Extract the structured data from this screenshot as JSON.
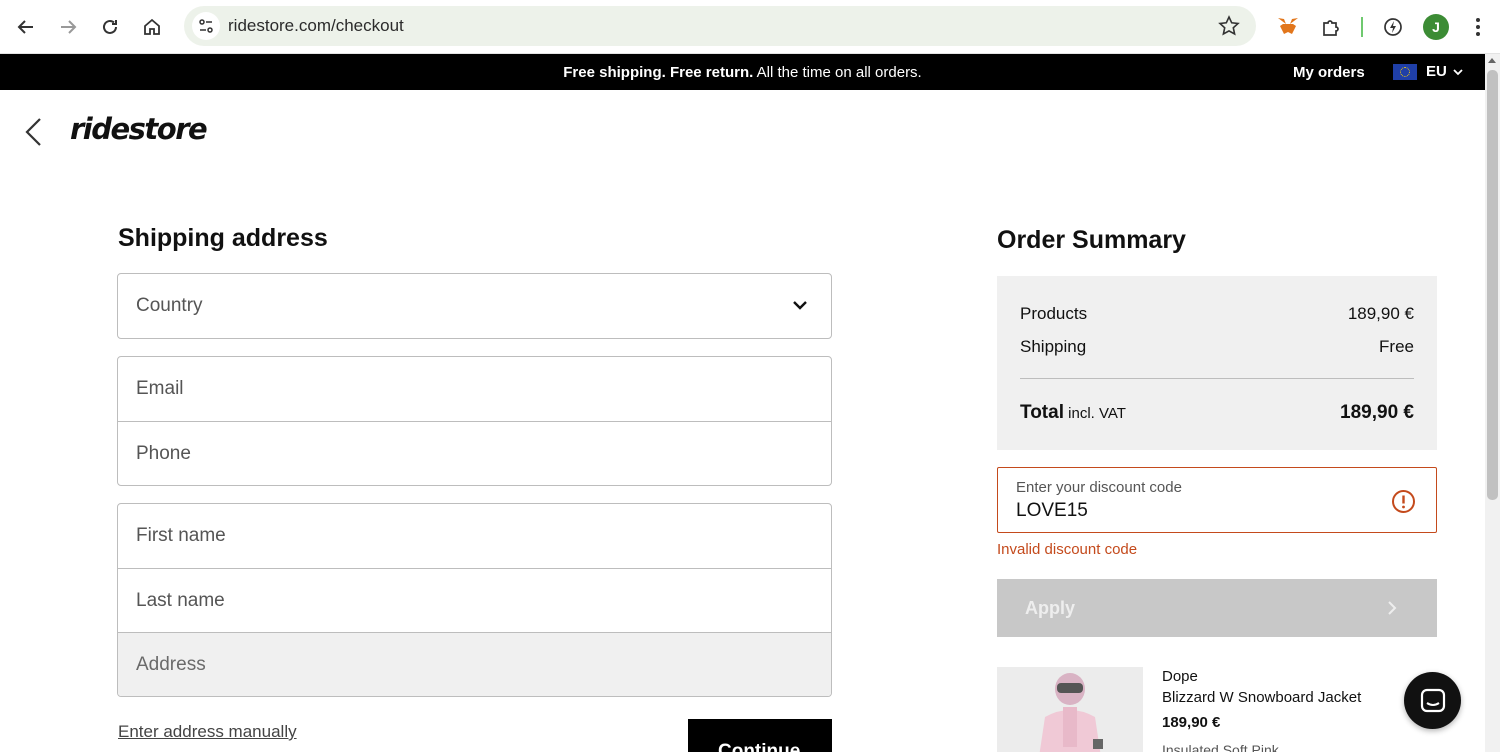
{
  "browser": {
    "url": "ridestore.com/checkout",
    "avatar_initial": "J"
  },
  "promo": {
    "bold_text": "Free shipping. Free return.",
    "rest_text": " All the time on all orders.",
    "my_orders": "My orders",
    "region": "EU"
  },
  "brand": {
    "logo_text": "ridestore"
  },
  "shipping": {
    "title": "Shipping address",
    "country_placeholder": "Country",
    "email_placeholder": "Email",
    "phone_placeholder": "Phone",
    "first_name_placeholder": "First name",
    "last_name_placeholder": "Last name",
    "address_placeholder": "Address",
    "manual_link": "Enter address manually",
    "continue_label": "Continue"
  },
  "summary": {
    "title": "Order Summary",
    "products_label": "Products",
    "products_value": "189,90 €",
    "shipping_label": "Shipping",
    "shipping_value": "Free",
    "total_label": "Total",
    "total_sub": " incl. VAT",
    "total_value": "189,90 €"
  },
  "discount": {
    "label": "Enter your discount code",
    "value": "LOVE15",
    "error": "Invalid discount code",
    "apply_label": "Apply"
  },
  "product": {
    "brand": "Dope",
    "name": "Blizzard W Snowboard Jacket",
    "price": "189,90 €",
    "variant": "Insulated    Soft Pink"
  },
  "colors": {
    "accent_error": "#c44a1c",
    "button_disabled": "#c8c8c8",
    "promo_bg": "#000000"
  }
}
